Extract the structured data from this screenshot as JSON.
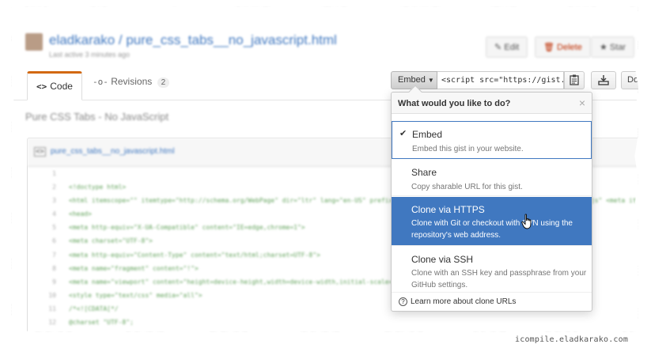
{
  "header": {
    "repo_title": "eladkarako / pure_css_tabs__no_javascript.html",
    "repo_subtitle": "Last active 3 minutes ago",
    "edit_label": "Edit",
    "delete_label": "Delete",
    "star_label": "Star"
  },
  "tabs": {
    "code_label": "Code",
    "revisions_label": "Revisions",
    "revisions_count": "2"
  },
  "toolbar": {
    "embed_label": "Embed",
    "embed_value": "<script src=\"https://gist.",
    "raw_label": "Do"
  },
  "description": "Pure CSS Tabs - No JavaScript",
  "file": {
    "name": "pure_css_tabs__no_javascript.html",
    "lines": [
      {
        "n": "1",
        "code": ""
      },
      {
        "n": "2",
        "code": "<!doctype html>"
      },
      {
        "n": "3",
        "code": "<html itemscope=\"\" itemtype=\"http://schema.org/WebPage\" dir=\"ltr\" lang=\"en-US\" prefix=\"og: http://ogp.me/ns#\" xml:lang=\"en-US\" class=\"no-js\" <meta itemprop=\"url\" content=\"https://gist.github.com/eladkarako\">"
      },
      {
        "n": "4",
        "code": "<head>"
      },
      {
        "n": "5",
        "code": "  <meta http-equiv=\"X-UA-Compatible\" content=\"IE=edge,chrome=1\">"
      },
      {
        "n": "6",
        "code": "  <meta charset=\"UTF-8\">"
      },
      {
        "n": "7",
        "code": "  <meta http-equiv=\"Content-Type\"     content=\"text/html;charset=UTF-8\">"
      },
      {
        "n": "8",
        "code": "  <meta name=\"fragment\"               content=\"!\">"
      },
      {
        "n": "9",
        "code": "  <meta name=\"viewport\"               content=\"height=device-height,width=device-width,initial-scale=1,minimum-scale=1,maximum-scale=1,user-scalable=no\">"
      },
      {
        "n": "10",
        "code": "  <style type=\"text/css\" media=\"all\">"
      },
      {
        "n": "11",
        "code": "    /*<![CDATA[*/"
      },
      {
        "n": "12",
        "code": "    @charset \"UTF-8\";"
      }
    ]
  },
  "dropdown": {
    "header": "What would you like to do?",
    "close_icon": "×",
    "check_icon": "✔",
    "items": [
      {
        "title": "Embed",
        "desc": "Embed this gist in your website."
      },
      {
        "title": "Share",
        "desc": "Copy sharable URL for this gist."
      },
      {
        "title": "Clone via HTTPS",
        "desc": "Clone with Git or checkout with SVN using the repository's web address."
      },
      {
        "title": "Clone via SSH",
        "desc": "Clone with an SSH key and passphrase from your GitHub settings."
      }
    ],
    "footer": "Learn more about clone URLs"
  },
  "watermark": "icompile.eladkarako.com",
  "colors": {
    "accent_blue": "#4078c0",
    "tab_orange": "#d26911",
    "code_green": "#63a35c"
  },
  "icons": [
    "code-icon",
    "history-icon",
    "clipboard-icon",
    "download-icon",
    "checkmark-icon",
    "close-icon",
    "question-icon",
    "file-code-icon",
    "hand-cursor-icon"
  ]
}
